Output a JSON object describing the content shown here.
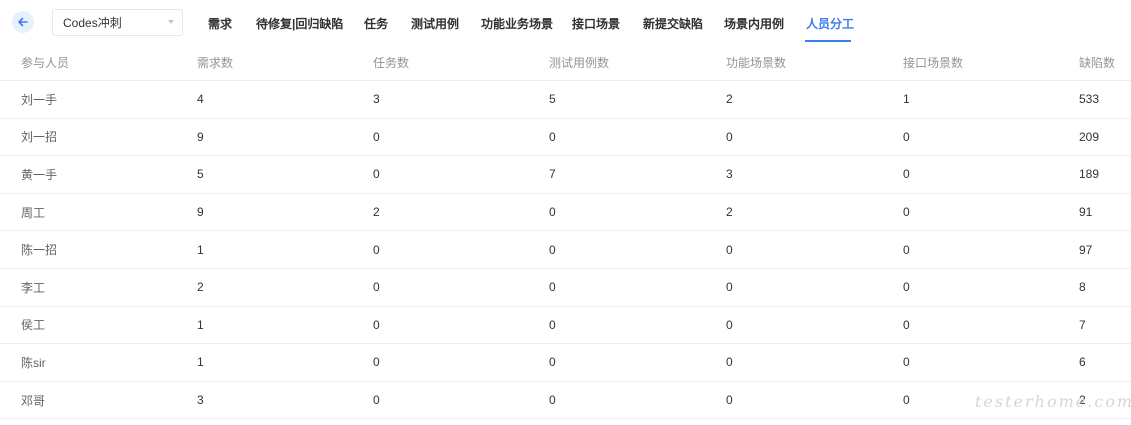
{
  "toolbar": {
    "back_icon": "arrow-left-icon",
    "project": "Codes冲刺"
  },
  "tabs": [
    {
      "label": "需求",
      "active": false
    },
    {
      "label": "待修复|回归缺陷",
      "active": false
    },
    {
      "label": "任务",
      "active": false
    },
    {
      "label": "测试用例",
      "active": false
    },
    {
      "label": "功能业务场景",
      "active": false
    },
    {
      "label": "接口场景",
      "active": false
    },
    {
      "label": "新提交缺陷",
      "active": false
    },
    {
      "label": "场景内用例",
      "active": false
    },
    {
      "label": "人员分工",
      "active": true
    }
  ],
  "colors": {
    "accent": "#3b7cf5",
    "border": "#ebeef5",
    "header_text": "#909399"
  },
  "table": {
    "columns": [
      "参与人员",
      "需求数",
      "任务数",
      "测试用例数",
      "功能场景数",
      "接口场景数",
      "缺陷数"
    ],
    "rows": [
      [
        "刘一手",
        "4",
        "3",
        "5",
        "2",
        "1",
        "533"
      ],
      [
        "刘一招",
        "9",
        "0",
        "0",
        "0",
        "0",
        "209"
      ],
      [
        "黄一手",
        "5",
        "0",
        "7",
        "3",
        "0",
        "189"
      ],
      [
        "周工",
        "9",
        "2",
        "0",
        "2",
        "0",
        "91"
      ],
      [
        "陈一招",
        "1",
        "0",
        "0",
        "0",
        "0",
        "97"
      ],
      [
        "李工",
        "2",
        "0",
        "0",
        "0",
        "0",
        "8"
      ],
      [
        "侯工",
        "1",
        "0",
        "0",
        "0",
        "0",
        "7"
      ],
      [
        "陈sir",
        "1",
        "0",
        "0",
        "0",
        "0",
        "6"
      ],
      [
        "邓哥",
        "3",
        "0",
        "0",
        "0",
        "0",
        "2"
      ]
    ]
  },
  "watermark": "testerhome.com"
}
